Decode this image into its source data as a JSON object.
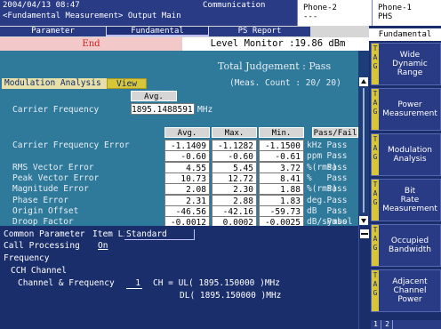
{
  "header": {
    "datetime": "2004/04/13 08:47",
    "mode": "<Fundamental Measurement> Output Main",
    "communication": "Communication",
    "phone2": {
      "title": "Phone-2",
      "status": "---"
    },
    "phone1": {
      "title": "Phone-1",
      "status": "PHS"
    }
  },
  "tabs": [
    {
      "label": "Parameter"
    },
    {
      "label": "Fundamental"
    },
    {
      "label": "PS Report"
    }
  ],
  "status": {
    "end_label": "End",
    "level_monitor": "Level Monitor :19.86 dBm"
  },
  "results": {
    "total_judgement": "Total Judgement : Pass",
    "modulation_analysis_label": "Modulation Analysis",
    "view_button": "View",
    "meas_count": "(Meas. Count :    20/  20)",
    "carrier_frequency": {
      "header": "Avg.",
      "label": "Carrier Frequency",
      "value": "1895.1488591",
      "unit": "MHz"
    },
    "columns": [
      "Avg.",
      "Max.",
      "Min.",
      "Pass/Fail"
    ],
    "rows": [
      {
        "label": "Carrier Frequency Error",
        "avg": "-1.1409",
        "max": "-1.1282",
        "min": "-1.1500",
        "unit": "kHz",
        "pass": "Pass"
      },
      {
        "label": "",
        "avg": "-0.60",
        "max": "-0.60",
        "min": "-0.61",
        "unit": "ppm",
        "pass": "Pass"
      },
      {
        "label": "RMS Vector Error",
        "avg": "4.55",
        "max": "5.45",
        "min": "3.72",
        "unit": "%(rms)",
        "pass": "Pass"
      },
      {
        "label": "Peak Vector Error",
        "avg": "10.73",
        "max": "12.72",
        "min": "8.41",
        "unit": "%",
        "pass": "Pass"
      },
      {
        "label": "Magnitude Error",
        "avg": "2.08",
        "max": "2.30",
        "min": "1.88",
        "unit": "%(rms)",
        "pass": "Pass"
      },
      {
        "label": "Phase Error",
        "avg": "2.31",
        "max": "2.88",
        "min": "1.83",
        "unit": "deg.",
        "pass": "Pass"
      },
      {
        "label": "Origin Offset",
        "avg": "-46.56",
        "max": "-42.16",
        "min": "-59.73",
        "unit": "dB",
        "pass": "Pass"
      },
      {
        "label": "Droop Factor",
        "avg": "-0.0012",
        "max": "0.0002",
        "min": "-0.0025",
        "unit": "dB/symbol",
        "pass": "Pass"
      }
    ]
  },
  "common": {
    "title": "Common Parameter",
    "item_list_label": "Item List",
    "item_list_value": "Standard",
    "call_processing_label": "Call Processing",
    "call_processing_value": "On",
    "frequency_label": "Frequency",
    "cch_label": "CCH Channel",
    "channel_label": "Channel & Frequency",
    "channel_value": "1",
    "ul_text": "CH = UL( 1895.150000 )MHz",
    "dl_text": "DL( 1895.150000 )MHz"
  },
  "side": {
    "title": "Fundamental",
    "softkeys": [
      {
        "lines": [
          "Wide",
          "Dynamic",
          "Range"
        ],
        "tag": "T\nA\nG"
      },
      {
        "lines": [
          "Power",
          "Measurement"
        ],
        "tag": "T\nA\nG"
      },
      {
        "lines": [
          "Modulation",
          "Analysis"
        ],
        "tag": "T\nA\nG"
      },
      {
        "lines": [
          "Bit",
          "Rate",
          "Measurement"
        ],
        "tag": "T\nA\nG"
      },
      {
        "lines": [
          "Occupied",
          "Bandwidth"
        ],
        "tag": "T\nA\nG"
      },
      {
        "lines": [
          "Adjacent",
          "Channel",
          "Power"
        ],
        "tag": "T\nA\nG"
      }
    ],
    "pages": [
      "1",
      "2"
    ]
  },
  "colors": {
    "header_bg": "#2a3b86",
    "panel_bg": "#2f7a9a",
    "lower_bg": "#1b2e6c",
    "accent_yellow": "#d8c63a",
    "end_red": "#cc2020"
  }
}
